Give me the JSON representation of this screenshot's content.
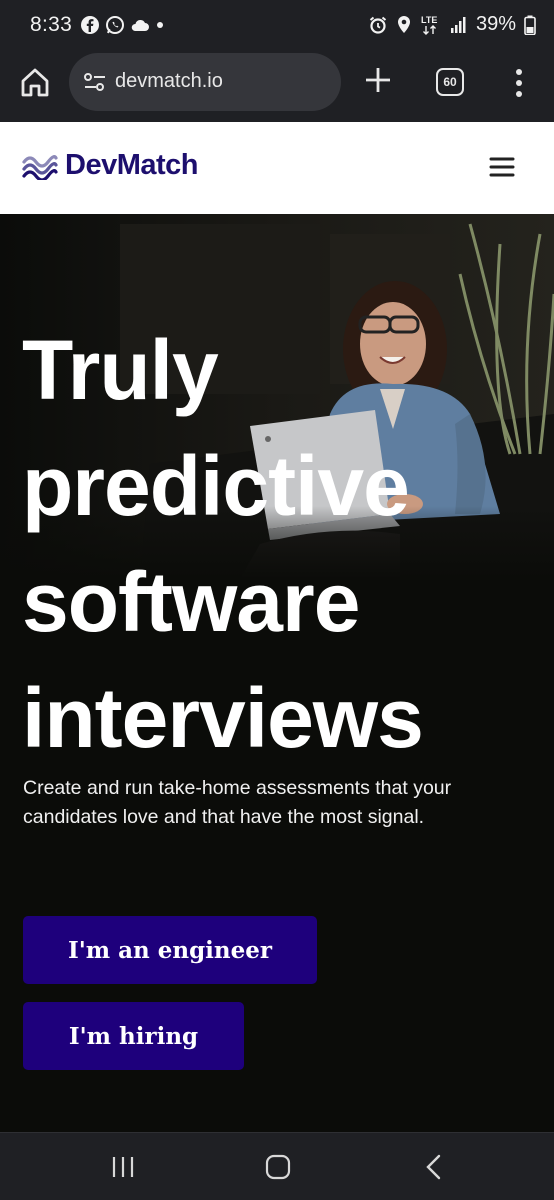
{
  "status_bar": {
    "time": "8:33",
    "battery": "39%",
    "network": "LTE",
    "left_icons": [
      "facebook-icon",
      "whatsapp-icon",
      "cloud-icon",
      "dot-icon"
    ],
    "right_icons": [
      "alarm-icon",
      "location-icon",
      "lte-icon",
      "signal-icon",
      "battery-icon"
    ]
  },
  "browser": {
    "url": "devmatch.io",
    "tab_count": "60"
  },
  "site": {
    "brand": "DevMatch",
    "brand_color": "#1d0f6e"
  },
  "hero": {
    "title_lines": [
      "Truly",
      "predictive",
      "software",
      "interviews"
    ],
    "subtitle": "Create and run take-home assessments that your candidates love and that have the most signal.",
    "cta_engineer": "I'm an engineer",
    "cta_hiring": "I'm hiring",
    "cta_color": "#1e007c"
  },
  "nav": {
    "icons": [
      "recent-apps-icon",
      "home-icon",
      "back-icon"
    ]
  }
}
